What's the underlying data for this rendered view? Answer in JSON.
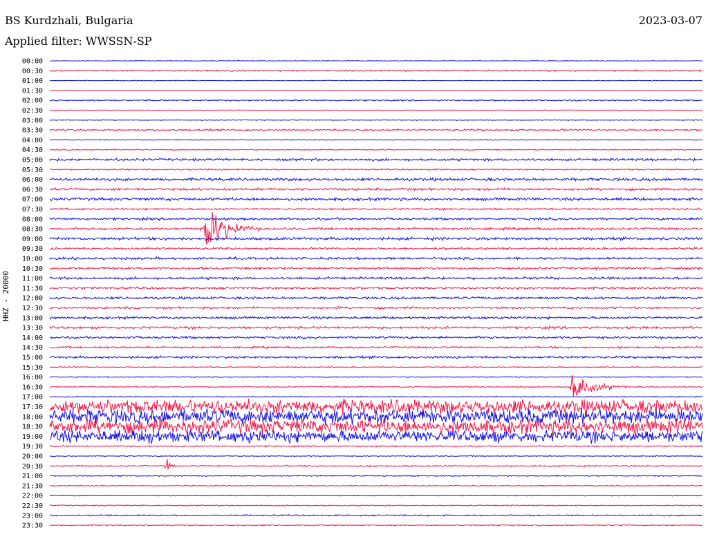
{
  "header": {
    "station": "BS Kurdzhali, Bulgaria",
    "date": "2023-03-07",
    "filter": "Applied filter: WWSSN-SP",
    "channel": "HHZ - 20000"
  },
  "colors": {
    "blue": "#1010e0",
    "red": "#f01848"
  },
  "chart_data": {
    "type": "line",
    "title": "BS Kurdzhali, Bulgaria",
    "ylabel": "HHZ - 20000",
    "rows": [
      "00:00",
      "00:30",
      "01:00",
      "01:30",
      "02:00",
      "02:30",
      "03:00",
      "03:30",
      "04:00",
      "04:30",
      "05:00",
      "05:30",
      "06:00",
      "06:30",
      "07:00",
      "07:30",
      "08:00",
      "08:30",
      "09:00",
      "09:30",
      "10:00",
      "10:30",
      "11:00",
      "11:30",
      "12:00",
      "12:30",
      "13:00",
      "13:30",
      "14:00",
      "14:30",
      "15:00",
      "15:30",
      "16:00",
      "16:30",
      "17:00",
      "17:30",
      "18:00",
      "18:30",
      "19:00",
      "19:30",
      "20:00",
      "20:30",
      "21:00",
      "21:30",
      "22:00",
      "22:30",
      "23:00",
      "23:30"
    ],
    "row_colors": [
      "blue",
      "red"
    ],
    "x_minutes": [
      0,
      30
    ],
    "noise_level": [
      0.3,
      0.6,
      0.3,
      0.3,
      0.6,
      0.3,
      0.3,
      0.8,
      0.3,
      0.5,
      1.0,
      0.6,
      1.2,
      1.0,
      1.2,
      0.8,
      1.0,
      1.0,
      1.2,
      0.9,
      1.0,
      1.0,
      1.0,
      0.9,
      1.0,
      0.9,
      1.0,
      1.0,
      1.0,
      0.8,
      1.0,
      0.5,
      0.4,
      0.5,
      0.4,
      6.0,
      6.0,
      6.0,
      5.0,
      0.6,
      0.4,
      0.6,
      0.5,
      0.4,
      0.4,
      0.5,
      0.6,
      0.5
    ],
    "events": [
      {
        "row": "08:30",
        "minute": 7.2,
        "peak": 22,
        "duration_min": 2.5
      },
      {
        "row": "16:30",
        "minute": 24.0,
        "peak": 14,
        "duration_min": 2.5
      },
      {
        "row": "19:00",
        "minute": 4.6,
        "peak": 10,
        "duration_min": 1.2
      },
      {
        "row": "19:00",
        "minute": 9.1,
        "peak": 9,
        "duration_min": 0.8
      },
      {
        "row": "20:30",
        "minute": 5.4,
        "peak": 6,
        "duration_min": 0.5
      }
    ]
  }
}
